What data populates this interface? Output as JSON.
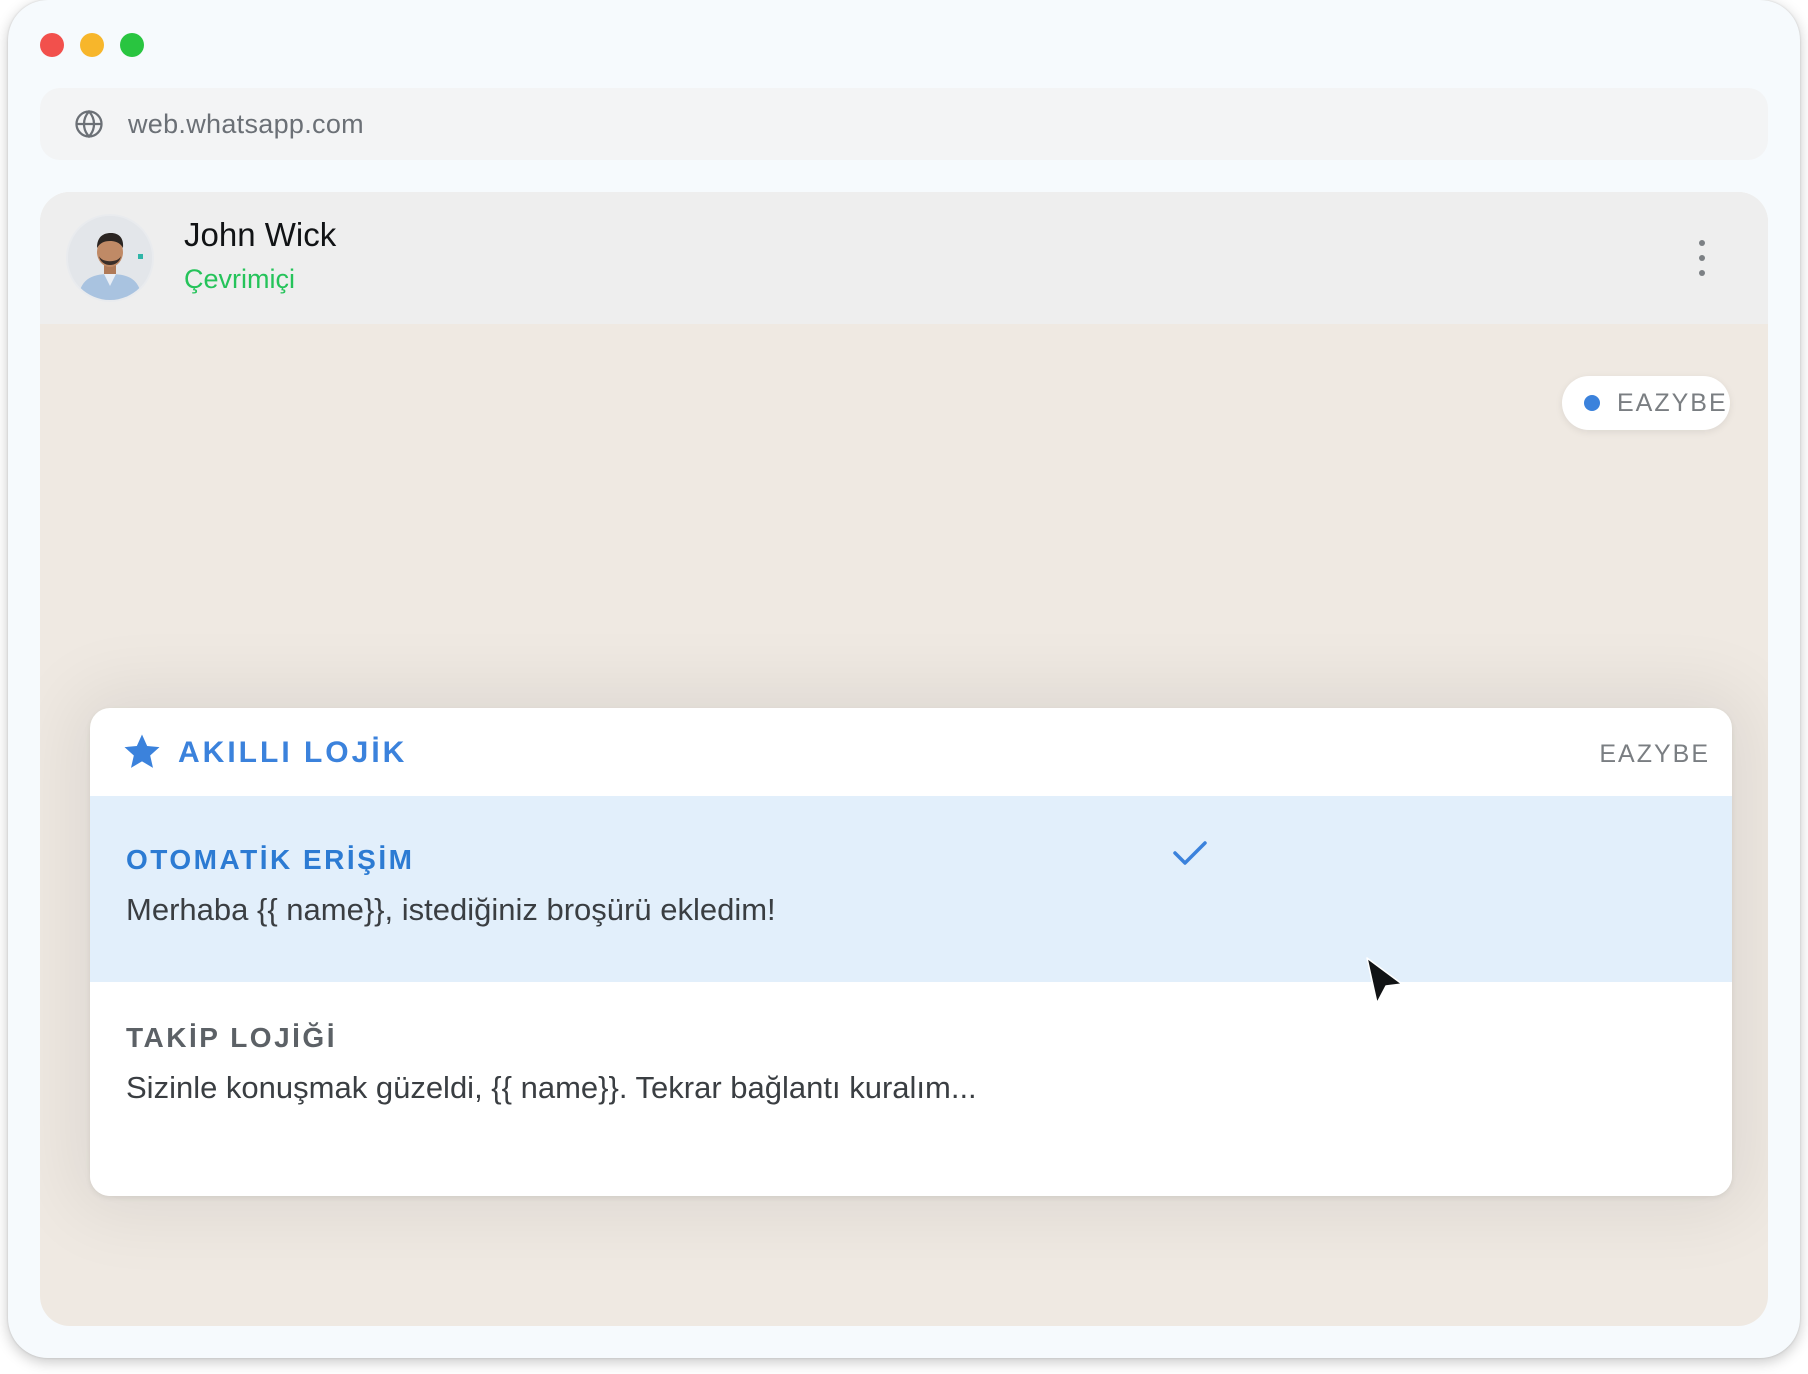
{
  "browser": {
    "url": "web.whatsapp.com",
    "traffic_lights": {
      "close": "#f2504c",
      "minimize": "#f7b62b",
      "maximize": "#29c540"
    }
  },
  "chat": {
    "contact_name": "John Wick",
    "contact_status": "Çevrimiçi",
    "badge_label": "EAZYBE"
  },
  "panel": {
    "title": "AKILLI LOJİK",
    "brand": "EAZYBE",
    "options": [
      {
        "title": "OTOMATİK ERİŞİM",
        "body": "Merhaba {{ name}}, istediğiniz broşürü ekledim!",
        "selected": true
      },
      {
        "title": "TAKİP LOJİĞİ",
        "body": "Sizinle konuşmak güzeldi, {{ name}}. Tekrar bağlantı kuralım...",
        "selected": false
      }
    ]
  },
  "colors": {
    "accent": "#3b82dc",
    "status_online": "#25c35a",
    "selected_row": "#e2effb",
    "chat_background": "#efe9e2"
  },
  "icons": [
    "globe-icon",
    "more-vertical-icon",
    "star-icon",
    "checkmark-icon",
    "mouse-cursor-icon"
  ]
}
